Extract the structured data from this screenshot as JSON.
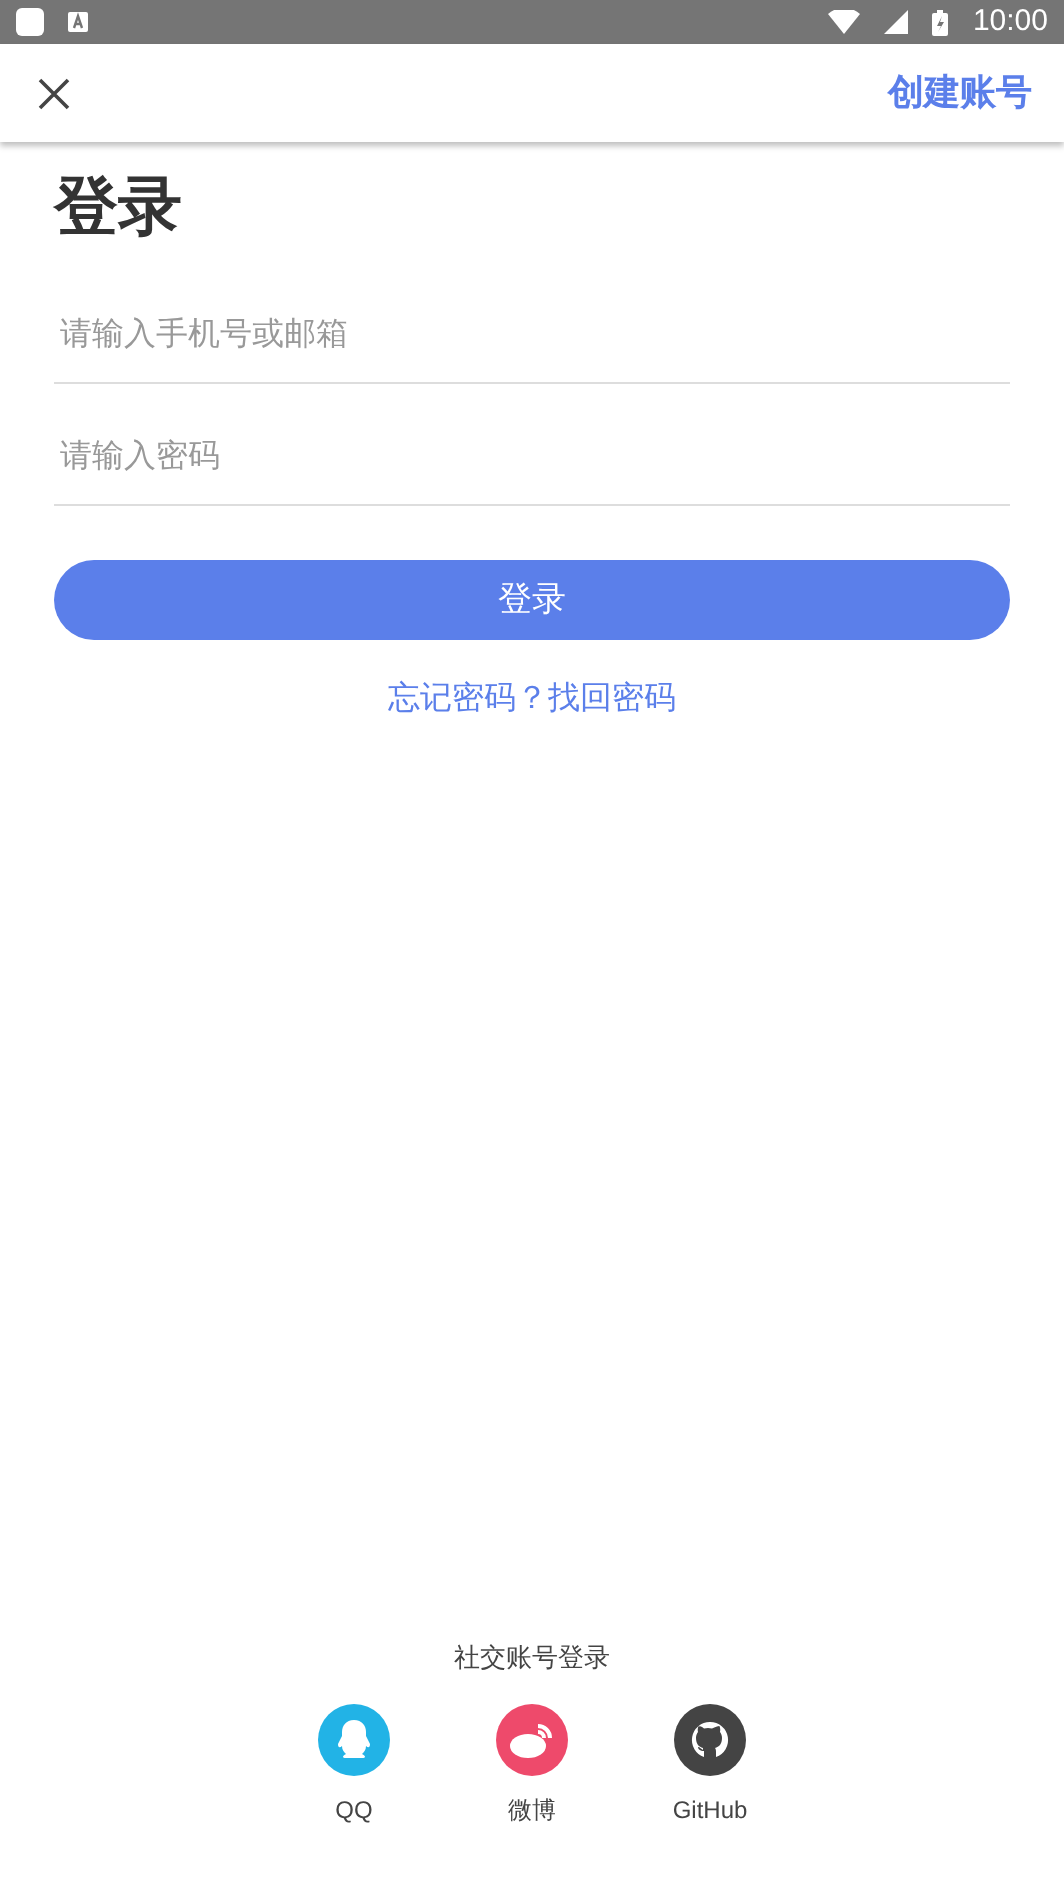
{
  "status_bar": {
    "time": "10:00"
  },
  "app_bar": {
    "action": "创建账号"
  },
  "title": "登录",
  "fields": [
    {
      "placeholder": "请输入手机号或邮箱"
    },
    {
      "placeholder": "请输入密码"
    }
  ],
  "login_button": "登录",
  "forgot_link": "忘记密码？找回密码",
  "social": {
    "heading": "社交账号登录",
    "items": [
      {
        "kind": "qq",
        "label": "QQ",
        "color": "#22b3e6"
      },
      {
        "kind": "weibo",
        "label": "微博",
        "color": "#ee4a6b"
      },
      {
        "kind": "github",
        "label": "GitHub",
        "color": "#444444"
      }
    ]
  }
}
